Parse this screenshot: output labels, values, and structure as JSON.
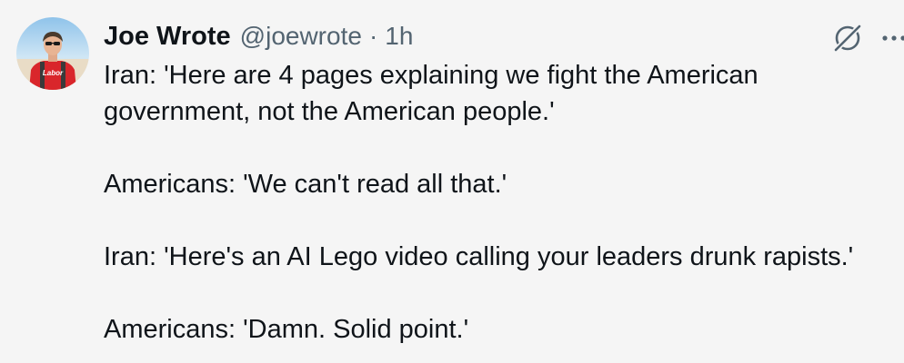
{
  "tweet": {
    "author": {
      "display_name": "Joe Wrote",
      "handle": "@joewrote",
      "avatar_shirt_text": "Labor"
    },
    "separator": "·",
    "time": "1h",
    "lines": [
      "Iran: 'Here are 4 pages explaining we fight the American",
      "government, not the American people.'",
      "Americans: 'We can't read all that.'",
      "Iran: 'Here's an AI Lego video calling your leaders drunk rapists.'",
      "Americans: 'Damn. Solid point.'"
    ],
    "icons": {
      "grok": "grok-icon",
      "more": "more-options-icon"
    }
  },
  "colors": {
    "background": "#f5f5f5",
    "text": "#0f1419",
    "secondary_text": "#536471",
    "shirt_red": "#d9262b"
  }
}
